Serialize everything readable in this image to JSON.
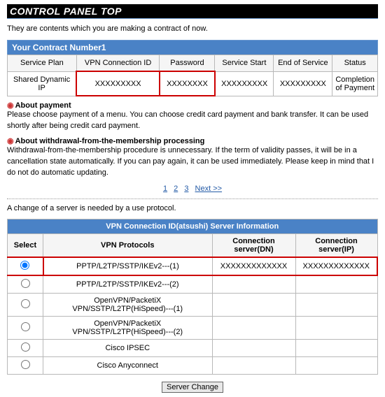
{
  "title": "CONTROL PANEL TOP",
  "intro": "They are contents which you are making a contract of now.",
  "contract": {
    "header": "Your Contract Number1",
    "columns": [
      "Service Plan",
      "VPN Connection ID",
      "Password",
      "Service Start",
      "End of Service",
      "Status"
    ],
    "row": {
      "plan": "Shared Dynamic IP",
      "vpn_id": "XXXXXXXXX",
      "password": "XXXXXXXX",
      "start": "XXXXXXXXX",
      "end": "XXXXXXXXX",
      "status": "Completion of Payment"
    }
  },
  "notes": {
    "payment_title": "About payment",
    "payment_body": "Please choose payment of a menu. You can choose credit card payment and bank transfer. It can be used shortly after being credit card payment.",
    "withdraw_title": "About withdrawal-from-the-membership processing",
    "withdraw_body": "Withdrawal-from-the-membership procedure is unnecessary. If the term of validity passes, it will be in a cancellation state automatically. If you can pay again, it can be used immediately. Please keep in mind that I do not do automatic updating."
  },
  "pager": {
    "p1": "1",
    "p2": "2",
    "p3": "3",
    "next": "Next >>"
  },
  "change_note": "A change of a server is needed by a use protocol.",
  "server_info": {
    "header": "VPN Connection ID(atsushi) Server Information",
    "columns": {
      "select": "Select",
      "protocols": "VPN Protocols",
      "dn": "Connection server(DN)",
      "ip": "Connection server(IP)"
    },
    "rows": [
      {
        "protocol": "PPTP/L2TP/SSTP/IKEv2---(1)",
        "dn": "XXXXXXXXXXXXX",
        "ip": "XXXXXXXXXXXXX",
        "checked": true
      },
      {
        "protocol": "PPTP/L2TP/SSTP/IKEv2---(2)",
        "dn": "",
        "ip": ""
      },
      {
        "protocol": "OpenVPN/PacketiX VPN/SSTP/L2TP(HiSpeed)---(1)",
        "dn": "",
        "ip": ""
      },
      {
        "protocol": "OpenVPN/PacketiX VPN/SSTP/L2TP(HiSpeed)---(2)",
        "dn": "",
        "ip": ""
      },
      {
        "protocol": "Cisco IPSEC",
        "dn": "",
        "ip": ""
      },
      {
        "protocol": "Cisco Anyconnect",
        "dn": "",
        "ip": ""
      }
    ]
  },
  "button": {
    "server_change": "Server Change"
  }
}
